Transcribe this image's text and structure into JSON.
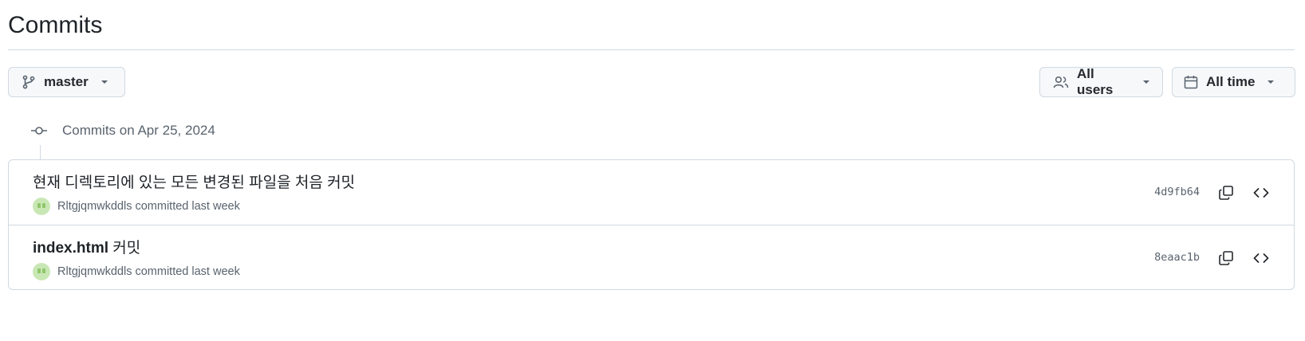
{
  "page": {
    "title": "Commits"
  },
  "filters": {
    "branch": {
      "label": "master",
      "icon": "git-branch-icon"
    },
    "users": {
      "label": "All users",
      "icon": "people-icon"
    },
    "time": {
      "label": "All time",
      "icon": "calendar-icon"
    }
  },
  "day_group": {
    "label": "Commits on Apr 25, 2024",
    "icon": "git-commit-icon"
  },
  "commits": [
    {
      "title_strong": "",
      "title_rest": "현재 디렉토리에 있는 모든 변경된 파일을 처음 커밋",
      "author": "Rltgjqmwkddls",
      "action": "committed",
      "time": "last week",
      "sha": "4d9fb64"
    },
    {
      "title_strong": "index.html",
      "title_rest": " 커밋",
      "author": "Rltgjqmwkddls",
      "action": "committed",
      "time": "last week",
      "sha": "8eaac1b"
    }
  ],
  "colors": {
    "text": "#1f2328",
    "muted": "#59636e",
    "border": "#d1d9e0",
    "button_bg": "#f6f8fa"
  }
}
